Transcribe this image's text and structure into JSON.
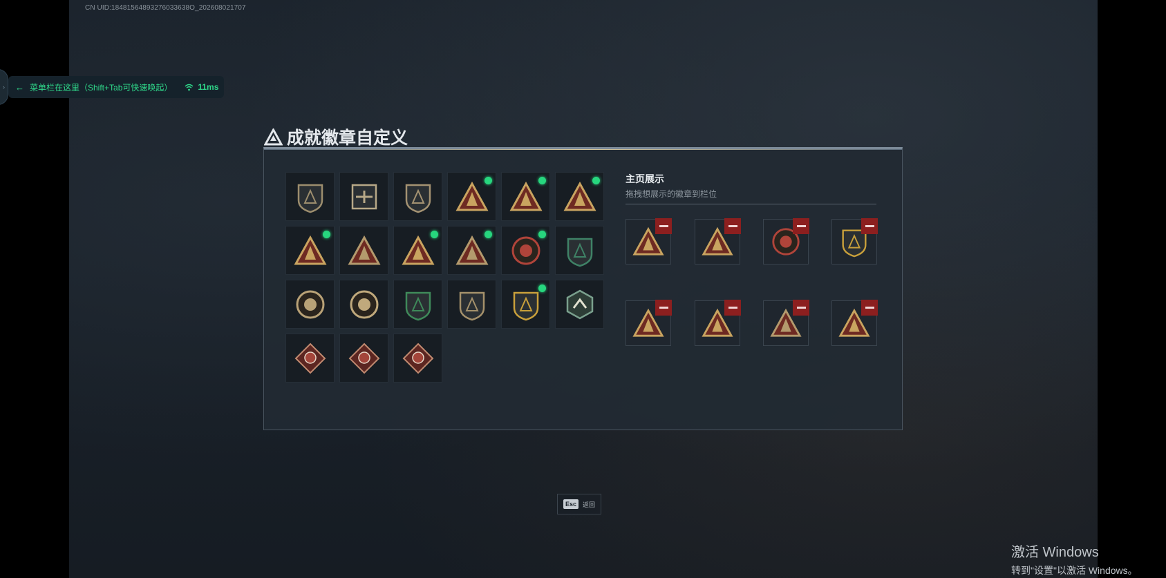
{
  "header": {
    "uid_text": "CN UID:18481564893276033638O_202608021707"
  },
  "overlay": {
    "hint_text": "菜单栏在这里（Shift+Tab可快速唤起）",
    "ping": "11ms"
  },
  "page": {
    "title": "成就徽章自定义"
  },
  "badges": [
    {
      "icon": "shield-triangle-badge",
      "shape": "shield",
      "color": "#9c8d6d",
      "new": false
    },
    {
      "icon": "helicopter-badge",
      "shape": "square",
      "color": "#b7a887",
      "new": false
    },
    {
      "icon": "blade-shield-badge",
      "shape": "shield",
      "color": "#a49272",
      "new": false
    },
    {
      "icon": "rock-hand-triangle-badge",
      "shape": "triangle",
      "color": "#c9a460",
      "new": true
    },
    {
      "icon": "helmet-triangle-badge",
      "shape": "triangle",
      "color": "#c9a460",
      "new": true
    },
    {
      "icon": "number-one-triangle-badge",
      "shape": "triangle",
      "color": "#c9a460",
      "new": true
    },
    {
      "icon": "crate-triangle-badge",
      "shape": "triangle",
      "color": "#c9a460",
      "new": true
    },
    {
      "icon": "soldiers-triangle-badge",
      "shape": "triangle",
      "color": "#b49a6d",
      "new": false
    },
    {
      "icon": "squad-triangle-badge",
      "shape": "triangle",
      "color": "#c9a460",
      "new": true
    },
    {
      "icon": "soldier-triangle-badge",
      "shape": "triangle",
      "color": "#b49a6d",
      "new": true
    },
    {
      "icon": "star-medal-badge",
      "shape": "circle",
      "color": "#b0443a",
      "new": true
    },
    {
      "icon": "green-crest-badge",
      "shape": "shield",
      "color": "#3f8266",
      "new": false
    },
    {
      "icon": "skull-compass-badge",
      "shape": "circle",
      "color": "#b9a277",
      "new": false
    },
    {
      "icon": "gasmask-badge",
      "shape": "circle",
      "color": "#c0a97c",
      "new": false
    },
    {
      "icon": "green-target-badge",
      "shape": "shield",
      "color": "#3f8a5a",
      "new": false
    },
    {
      "icon": "rifle-shield-badge",
      "shape": "shield",
      "color": "#a5916b",
      "new": false
    },
    {
      "icon": "gold-crest-badge",
      "shape": "shield",
      "color": "#c9a03b",
      "new": true
    },
    {
      "icon": "eagle-hex-badge",
      "shape": "hex",
      "color": "#7aa08d",
      "new": false
    },
    {
      "icon": "dragon-red-badge-1",
      "shape": "diamond",
      "color": "#a4453a",
      "new": false
    },
    {
      "icon": "dragon-red-badge-2",
      "shape": "diamond",
      "color": "#a4453a",
      "new": false
    },
    {
      "icon": "runner-red-badge",
      "shape": "diamond",
      "color": "#a4453a",
      "new": false
    }
  ],
  "display": {
    "title": "主页展示",
    "subtitle": "拖拽想展示的徽章到栏位",
    "slots": [
      {
        "icon": "crate-triangle-badge",
        "shape": "triangle",
        "color": "#c9a460"
      },
      {
        "icon": "helmet-triangle-badge",
        "shape": "triangle",
        "color": "#c9a460"
      },
      {
        "icon": "star-medal-badge",
        "shape": "circle",
        "color": "#b0443a"
      },
      {
        "icon": "gold-crest-badge",
        "shape": "shield",
        "color": "#c9a03b"
      },
      {
        "icon": "rock-hand-triangle-badge",
        "shape": "triangle",
        "color": "#c9a460"
      },
      {
        "icon": "squad-triangle-badge",
        "shape": "triangle",
        "color": "#c9a460"
      },
      {
        "icon": "soldier-triangle-badge",
        "shape": "triangle",
        "color": "#b49a6d"
      },
      {
        "icon": "number-one-triangle-badge",
        "shape": "triangle",
        "color": "#c9a460"
      }
    ]
  },
  "footer": {
    "esc_key": "Esc",
    "esc_label": "返回"
  },
  "watermark": {
    "line1": "激活 Windows",
    "line2": "转到\"设置\"以激活 Windows。"
  }
}
